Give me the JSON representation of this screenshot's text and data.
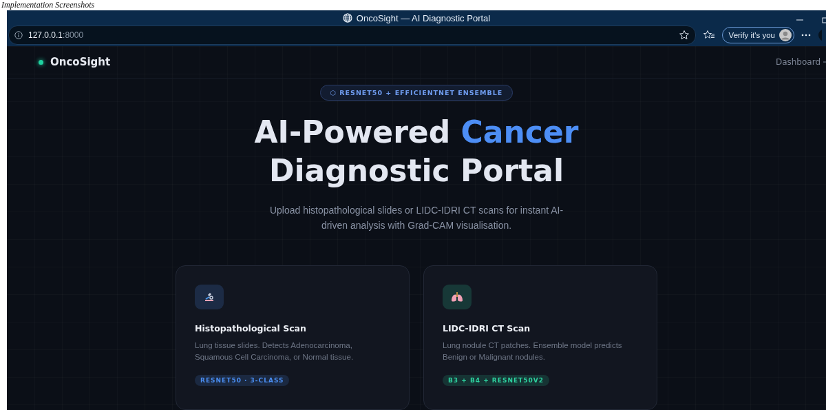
{
  "caption": "Implementation Screenshots",
  "window": {
    "title": "OncoSight — AI Diagnostic Portal"
  },
  "address_bar": {
    "host": "127.0.0.1",
    "port": ":8000"
  },
  "profile_button": {
    "label": "Verify it's you"
  },
  "nav": {
    "brand": "OncoSight",
    "link": "Dashboard"
  },
  "hero": {
    "badge": "⬡ RESNET50 + EFFICIENTNET ENSEMBLE",
    "heading_start": "AI-Powered",
    "heading_highlight": "Cancer",
    "heading_end": "Diagnostic Portal",
    "subtitle": "Upload histopathological slides or LIDC-IDRI CT scans for instant AI-driven analysis with Grad-CAM visualisation."
  },
  "cards": [
    {
      "kind": "microscope",
      "title": "Histopathological Scan",
      "description": "Lung tissue slides. Detects Adenocarcinoma, Squamous Cell Carcinoma, or Normal tissue.",
      "tag": "RESNET50 · 3-CLASS"
    },
    {
      "kind": "lungs",
      "title": "LIDC-IDRI CT Scan",
      "description": "Lung nodule CT patches. Ensemble model predicts Benign or Malignant nodules.",
      "tag": "B3 + B4 + RESNET50V2"
    }
  ]
}
